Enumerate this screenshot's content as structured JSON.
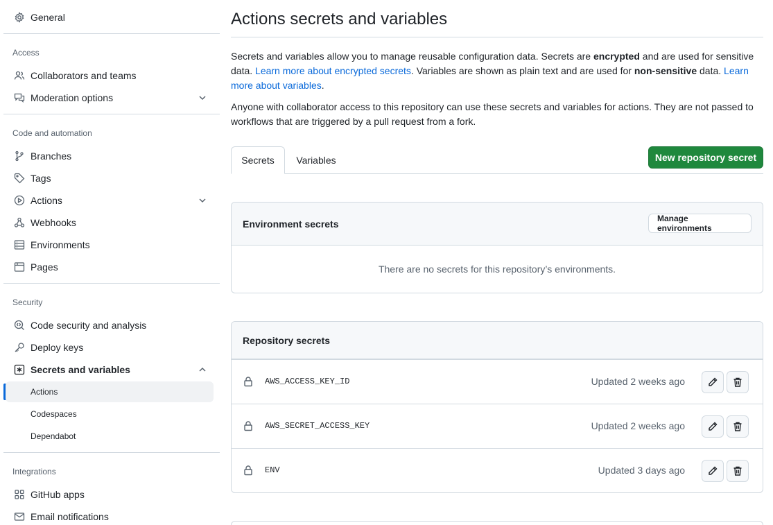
{
  "sidebar": {
    "general": "General",
    "access_heading": "Access",
    "collaborators": "Collaborators and teams",
    "moderation": "Moderation options",
    "code_heading": "Code and automation",
    "branches": "Branches",
    "tags": "Tags",
    "actions": "Actions",
    "webhooks": "Webhooks",
    "environments": "Environments",
    "pages": "Pages",
    "security_heading": "Security",
    "code_security": "Code security and analysis",
    "deploy_keys": "Deploy keys",
    "secrets_vars": "Secrets and variables",
    "sub_actions": "Actions",
    "sub_codespaces": "Codespaces",
    "sub_dependabot": "Dependabot",
    "integrations_heading": "Integrations",
    "github_apps": "GitHub apps",
    "email_notifications": "Email notifications"
  },
  "main": {
    "title": "Actions secrets and variables",
    "intro": {
      "t1": "Secrets and variables allow you to manage reusable configuration data. Secrets are ",
      "b1": "encrypted",
      "t2": " and are used for sensitive data. ",
      "link1": "Learn more about encrypted secrets",
      "t3": ". Variables are shown as plain text and are used for ",
      "b2": "non-sensitive",
      "t4": " data. ",
      "link2": "Learn more about variables",
      "t5": "."
    },
    "access_note": "Anyone with collaborator access to this repository can use these secrets and variables for actions. They are not passed to workflows that are triggered by a pull request from a fork.",
    "tabs": {
      "secrets": "Secrets",
      "variables": "Variables"
    },
    "new_secret_button": "New repository secret",
    "env_secrets": {
      "title": "Environment secrets",
      "manage_button": "Manage environments",
      "empty": "There are no secrets for this repository’s environments."
    },
    "repo_secrets": {
      "title": "Repository secrets",
      "rows": [
        {
          "name": "AWS_ACCESS_KEY_ID",
          "updated": "Updated 2 weeks ago"
        },
        {
          "name": "AWS_SECRET_ACCESS_KEY",
          "updated": "Updated 2 weeks ago"
        },
        {
          "name": "ENV",
          "updated": "Updated 3 days ago"
        }
      ]
    }
  },
  "colors": {
    "primary_button": "#1f883d",
    "link": "#0969da",
    "active_indicator": "#0969da",
    "border": "#d1d9e0",
    "muted_text": "#59636e"
  },
  "icons": {
    "general": "gear-icon",
    "collaborators": "people-icon",
    "moderation": "comment-discussion-icon",
    "branches": "git-branch-icon",
    "tags": "tag-icon",
    "actions": "play-icon",
    "webhooks": "webhook-icon",
    "environments": "server-icon",
    "pages": "browser-icon",
    "code_security": "codescan-icon",
    "deploy_keys": "key-icon",
    "secrets_vars": "key-asterisk-icon",
    "github_apps": "apps-icon",
    "email_notifications": "mail-icon",
    "secret_row": "lock-icon",
    "edit": "pencil-icon",
    "delete": "trash-icon"
  }
}
